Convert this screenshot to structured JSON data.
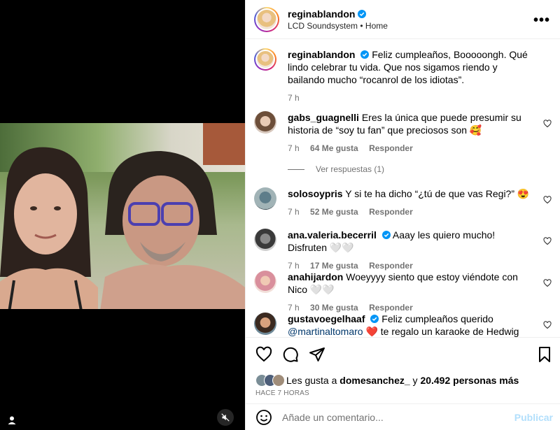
{
  "post": {
    "username": "reginablandon",
    "subtitle": "LCD Soundsystem • Home",
    "more_icon": "more-horizontal-icon"
  },
  "caption": {
    "username": "reginablandon",
    "text": "Feliz cumpleaños, Booooongh. Qué lindo celebrar tu vida. Que nos sigamos riendo y bailando mucho “rocanrol de los idiotas”.",
    "time": "7 h"
  },
  "comments": [
    {
      "username": "gabs_guagnelli",
      "text": "Eres la única que puede presumir su historia de “soy tu fan” que preciosos son 🥰",
      "time": "7 h",
      "likes": "64 Me gusta",
      "reply": "Responder"
    },
    {
      "username": "solosoypris",
      "text": "Y si te ha dicho “¿tú de que vas Regi?” 😍",
      "time": "7 h",
      "likes": "52 Me gusta",
      "reply": "Responder"
    },
    {
      "username": "ana.valeria.becerril",
      "text": "Aaay les quiero mucho! Disfruten 🤍🤍",
      "time": "7 h",
      "likes": "17 Me gusta",
      "reply": "Responder"
    },
    {
      "username": "anahijardon",
      "text": "Woeyyyy siento que estoy viéndote con Nico 🤍🤍",
      "time": "7 h",
      "likes": "30 Me gusta",
      "reply": "Responder"
    },
    {
      "username": "gustavoegelhaaf",
      "text_before": "Feliz cumpleaños querido",
      "mention": "@martinaltomaro",
      "text_after": "❤️  te regalo un karaoke de Hedwig"
    }
  ],
  "replies_link": "Ver respuestas (1)",
  "likes": {
    "prefix": "Les gusta a",
    "user": "domesanchez_",
    "middle": "y",
    "count": "20.492 personas más"
  },
  "time_ago": "HACE 7 HORAS",
  "add_comment": {
    "placeholder": "Añade un comentario...",
    "publish": "Publicar"
  },
  "colors": {
    "verified": "#0095f6",
    "muted_text": "#737373",
    "mention": "#00376b",
    "publish_disabled": "#b2dffc"
  }
}
